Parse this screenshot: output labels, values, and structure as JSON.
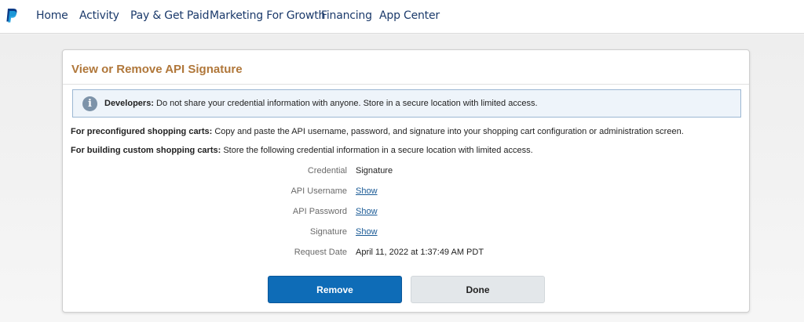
{
  "nav": {
    "logo_icon": "paypal-logo-icon",
    "items": [
      {
        "label": "Home"
      },
      {
        "label": "Activity"
      },
      {
        "label": "Pay & Get Paid"
      },
      {
        "label": "Marketing For Growth"
      },
      {
        "label": "Financing"
      },
      {
        "label": "App Center"
      }
    ]
  },
  "card": {
    "title": "View or Remove API Signature",
    "alert": {
      "icon": "info-icon",
      "strong": "Developers:",
      "text": " Do not share your credential information with anyone. Store in a secure location with limited access."
    },
    "preconfigured": {
      "strong": "For preconfigured shopping carts:",
      "text": " Copy and paste the API username, password, and signature into your shopping cart configuration or administration screen."
    },
    "custom": {
      "strong": "For building custom shopping carts:",
      "text": " Store the following credential information in a secure location with limited access."
    },
    "fields": {
      "credential": {
        "label": "Credential",
        "value": "Signature"
      },
      "api_username": {
        "label": "API Username",
        "value": "Show"
      },
      "api_password": {
        "label": "API Password",
        "value": "Show"
      },
      "signature": {
        "label": "Signature",
        "value": "Show"
      },
      "request_date": {
        "label": "Request Date",
        "value": "April 11, 2022 at 1:37:49 AM PDT"
      }
    },
    "buttons": {
      "remove": "Remove",
      "done": "Done"
    }
  },
  "colors": {
    "title": "#b0773a",
    "nav_text": "#1b3a6b",
    "primary_button": "#0e6cb7",
    "secondary_button": "#e3e7ea",
    "link": "#1a5a96",
    "alert_bg": "#eef4fa",
    "alert_border": "#9cb7d3"
  }
}
